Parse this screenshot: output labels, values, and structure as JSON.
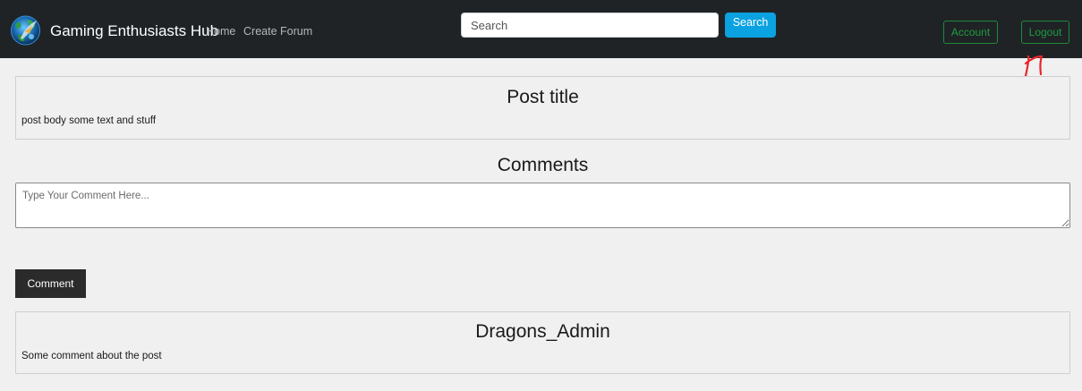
{
  "navbar": {
    "brand_title": "Gaming Enthusiasts Hub",
    "links": [
      {
        "label": "Home"
      },
      {
        "label": "Create Forum"
      }
    ],
    "search": {
      "placeholder": "Search",
      "value": "",
      "button_label": "Search"
    },
    "account_label": "Account",
    "logout_label": "Logout"
  },
  "post": {
    "title": "Post title",
    "body": "post body some text and stuff"
  },
  "comments_section": {
    "heading": "Comments",
    "textarea_placeholder": "Type Your Comment Here...",
    "textarea_value": "",
    "submit_label": "Comment",
    "items": [
      {
        "author": "Dragons_Admin",
        "text": "Some comment about the post"
      }
    ]
  },
  "colors": {
    "navbar_bg": "#1f2326",
    "search_button": "#0aa2e0",
    "outline_button": "#1f9b40",
    "comment_button": "#2b2b2b",
    "annotation": "#e8252a"
  },
  "icons": {
    "logo": "dragon-globe-logo",
    "annotation": "red-arrow-annotation"
  }
}
